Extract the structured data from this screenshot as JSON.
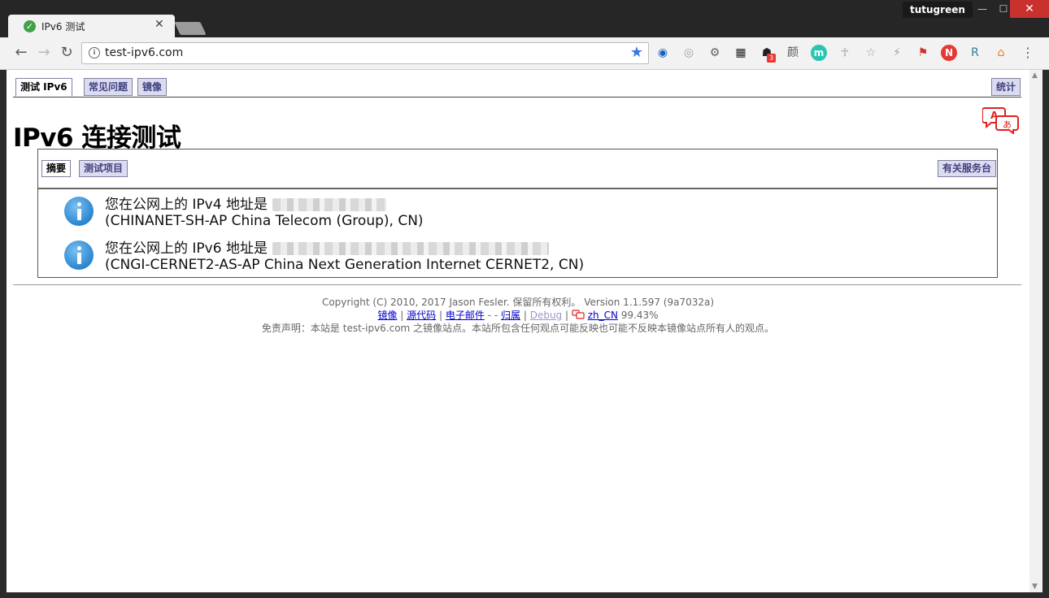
{
  "browser": {
    "tab_title": "IPv6 测试",
    "tab_close": "✕",
    "profile": "tutugreen",
    "url": "test-ipv6.com",
    "window_controls": {
      "minimize": "—",
      "maximize": "☐",
      "close": "✕"
    },
    "icons": {
      "back": "←",
      "forward": "→",
      "reload": "↻",
      "star": "★",
      "menu": "⋮"
    },
    "extensions": [
      {
        "name": "color-wheel-icon",
        "glyph": "◉",
        "color": "#1565c0"
      },
      {
        "name": "ring-icon",
        "glyph": "◎",
        "color": "#9e9e9e"
      },
      {
        "name": "gear-icon",
        "glyph": "⚙",
        "color": "#616161"
      },
      {
        "name": "qr-code-icon",
        "glyph": "▦",
        "color": "#212121"
      },
      {
        "name": "ghost-icon",
        "glyph": "☗",
        "color": "#212121",
        "badge": "3"
      },
      {
        "name": "color-text-icon",
        "glyph": "颜",
        "color": "#555555"
      },
      {
        "name": "m-circle-icon",
        "glyph": "m",
        "color": "#ffffff",
        "bg": "#26c6b0"
      },
      {
        "name": "ankh-icon",
        "glyph": "☥",
        "color": "#9e9e9e"
      },
      {
        "name": "outline-star-icon",
        "glyph": "☆",
        "color": "#9e9e9e"
      },
      {
        "name": "bolt-icon",
        "glyph": "⚡",
        "color": "#9e9e9e"
      },
      {
        "name": "flag-icon",
        "glyph": "⚑",
        "color": "#d32f2f"
      },
      {
        "name": "shield-n-icon",
        "glyph": "N",
        "color": "#ffffff",
        "bg": "#e53935"
      },
      {
        "name": "r-icon",
        "glyph": "R",
        "color": "#2e7d9a"
      },
      {
        "name": "home-chart-icon",
        "glyph": "⌂",
        "color": "#f57c00"
      }
    ]
  },
  "nav": {
    "test": "测试 IPv6",
    "faq": "常见问题",
    "mirror": "镜像",
    "stats": "统计"
  },
  "page": {
    "title": "IPv6 连接测试"
  },
  "subtabs": {
    "summary": "摘要",
    "tests": "测试项目",
    "help": "有关服务台"
  },
  "results": {
    "v4_label": "您在公网上的 IPv4 地址是",
    "v4_isp": "(CHINANET-SH-AP China Telecom (Group), CN)",
    "v6_label": "您在公网上的 IPv6 地址是",
    "v6_isp": "(CNGI-CERNET2-AS-AP China Next Generation Internet CERNET2, CN)"
  },
  "footer": {
    "copyright": "Copyright (C) 2010, 2017 Jason Fesler. 保留所有权利。 Version 1.1.597 (9a7032a)",
    "link_mirror": "镜像",
    "link_source": "源代码",
    "link_email": "电子邮件",
    "dash": " - ",
    "link_attribution": "归属",
    "link_debug": "Debug",
    "link_locale": "zh_CN",
    "locale_pct": "99.43%",
    "disclaimer": "免责声明：本站是 test-ipv6.com 之镜像站点。本站所包含任何观点可能反映也可能不反映本镜像站点所有人的观点。"
  }
}
